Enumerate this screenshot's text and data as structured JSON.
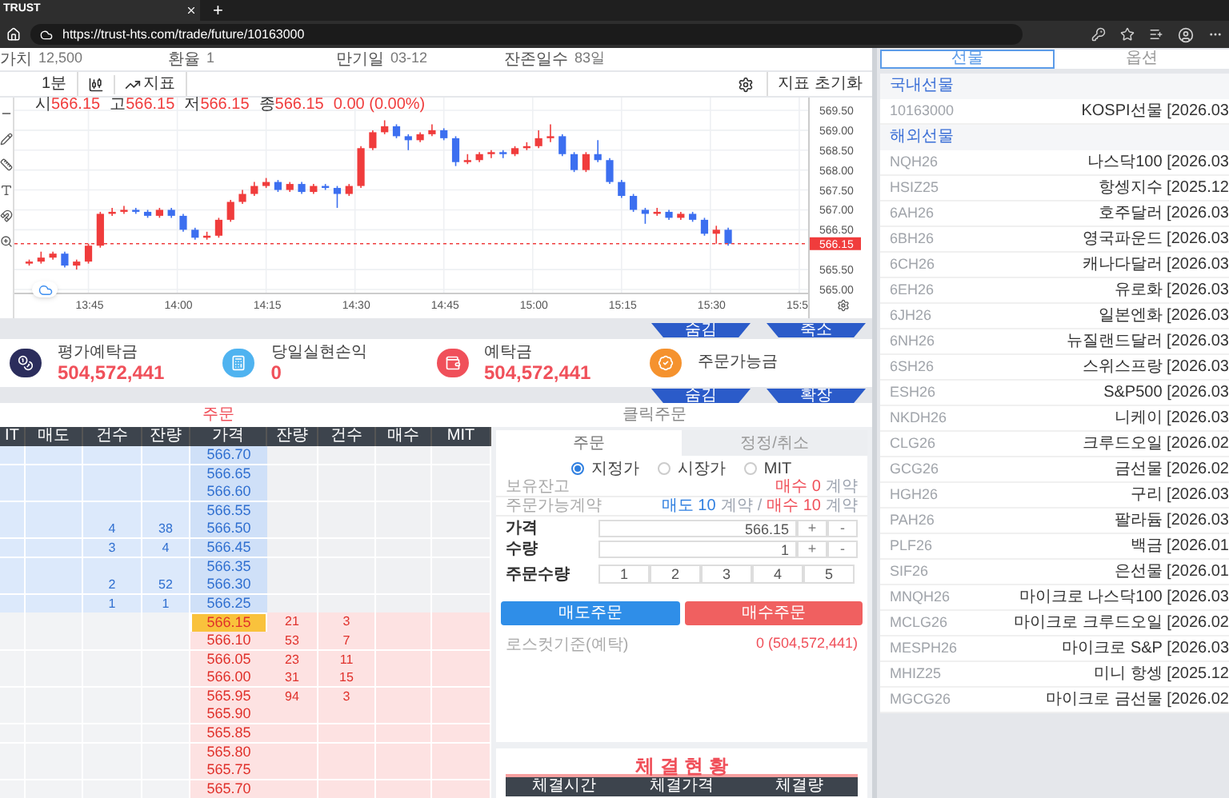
{
  "browser": {
    "tab_title": "TRUST",
    "new_tab": "+",
    "url": "https://trust-hts.com/trade/future/10163000"
  },
  "info": [
    {
      "label": "가치",
      "value": "12,500"
    },
    {
      "label": "환율",
      "value": "1"
    },
    {
      "label": "만기일",
      "value": "03-12"
    },
    {
      "label": "잔존일수",
      "value": "83일"
    }
  ],
  "toolbar": {
    "interval": "1분",
    "indicator": "지표",
    "reset": "지표 초기화"
  },
  "chart": {
    "ohlc": [
      {
        "label": "시",
        "value": "566.15"
      },
      {
        "label": "고",
        "value": "566.15"
      },
      {
        "label": "저",
        "value": "566.15"
      },
      {
        "label": "종",
        "value": "566.15"
      }
    ],
    "change": "0.00 (0.00%)",
    "chart_data": {
      "type": "candlestick",
      "x": [
        815,
        817,
        819,
        821,
        823,
        825,
        827,
        829,
        831,
        833,
        835,
        837,
        839,
        841,
        843,
        845,
        847,
        849,
        851,
        853,
        855,
        857,
        859,
        861,
        863,
        865,
        867,
        869,
        871,
        873,
        875,
        877,
        879,
        881,
        883,
        885,
        887,
        889,
        891,
        893,
        895,
        897,
        899,
        901,
        903,
        905,
        907,
        909,
        911,
        913,
        915,
        917,
        919,
        921,
        923,
        925,
        927,
        929,
        931,
        933
      ],
      "ohlc": [
        [
          565.65,
          565.75,
          565.6,
          565.7
        ],
        [
          565.7,
          565.95,
          565.65,
          565.8
        ],
        [
          565.8,
          565.95,
          565.75,
          565.9
        ],
        [
          565.9,
          565.95,
          565.55,
          565.6
        ],
        [
          565.6,
          565.75,
          565.5,
          565.7
        ],
        [
          565.7,
          566.15,
          565.65,
          566.1
        ],
        [
          566.1,
          566.95,
          566.05,
          566.9
        ],
        [
          566.9,
          567.05,
          566.85,
          566.95
        ],
        [
          566.95,
          567.1,
          566.9,
          567.0
        ],
        [
          567.0,
          567.05,
          566.9,
          566.95
        ],
        [
          566.95,
          567.0,
          566.8,
          566.85
        ],
        [
          566.85,
          567.05,
          566.8,
          567.0
        ],
        [
          567.0,
          567.05,
          566.8,
          566.85
        ],
        [
          566.85,
          566.9,
          566.45,
          566.5
        ],
        [
          566.5,
          566.55,
          566.25,
          566.3
        ],
        [
          566.3,
          566.45,
          566.25,
          566.35
        ],
        [
          566.35,
          566.8,
          566.3,
          566.75
        ],
        [
          566.75,
          567.25,
          566.7,
          567.2
        ],
        [
          567.2,
          567.5,
          567.15,
          567.4
        ],
        [
          567.4,
          567.7,
          567.35,
          567.6
        ],
        [
          567.6,
          567.8,
          567.55,
          567.7
        ],
        [
          567.7,
          567.75,
          567.45,
          567.5
        ],
        [
          567.5,
          567.7,
          567.45,
          567.65
        ],
        [
          567.65,
          567.7,
          567.4,
          567.45
        ],
        [
          567.45,
          567.65,
          567.4,
          567.6
        ],
        [
          567.6,
          567.65,
          567.5,
          567.55
        ],
        [
          567.55,
          567.6,
          567.05,
          567.4
        ],
        [
          567.4,
          567.65,
          567.35,
          567.6
        ],
        [
          567.6,
          568.6,
          567.55,
          568.55
        ],
        [
          568.55,
          569.0,
          568.5,
          568.95
        ],
        [
          568.95,
          569.25,
          568.9,
          569.1
        ],
        [
          569.1,
          569.15,
          568.8,
          568.85
        ],
        [
          568.85,
          568.9,
          568.5,
          568.75
        ],
        [
          568.75,
          568.95,
          568.7,
          568.9
        ],
        [
          568.9,
          569.15,
          568.85,
          569.0
        ],
        [
          569.0,
          569.05,
          568.75,
          568.8
        ],
        [
          568.8,
          568.85,
          568.1,
          568.2
        ],
        [
          568.2,
          568.4,
          568.15,
          568.25
        ],
        [
          568.25,
          568.45,
          568.2,
          568.4
        ],
        [
          568.4,
          568.5,
          568.3,
          568.45
        ],
        [
          568.45,
          568.5,
          568.3,
          568.4
        ],
        [
          568.4,
          568.6,
          568.35,
          568.55
        ],
        [
          568.55,
          568.7,
          568.5,
          568.6
        ],
        [
          568.6,
          569.0,
          568.55,
          568.8
        ],
        [
          568.8,
          569.15,
          568.7,
          568.85
        ],
        [
          568.85,
          568.9,
          568.35,
          568.4
        ],
        [
          568.4,
          568.45,
          567.95,
          568.0
        ],
        [
          568.0,
          568.45,
          567.95,
          568.4
        ],
        [
          568.4,
          568.75,
          568.2,
          568.25
        ],
        [
          568.25,
          568.3,
          567.65,
          567.7
        ],
        [
          567.7,
          567.75,
          567.3,
          567.35
        ],
        [
          567.35,
          567.4,
          566.95,
          567.0
        ],
        [
          567.0,
          567.05,
          566.65,
          566.9
        ],
        [
          566.9,
          567.05,
          566.85,
          566.95
        ],
        [
          566.95,
          567.0,
          566.75,
          566.8
        ],
        [
          566.8,
          566.95,
          566.75,
          566.9
        ],
        [
          566.9,
          566.95,
          566.7,
          566.75
        ],
        [
          566.75,
          566.8,
          566.35,
          566.4
        ],
        [
          566.4,
          566.6,
          566.15,
          566.5
        ],
        [
          566.5,
          566.55,
          566.1,
          566.15
        ]
      ],
      "xticks": [
        {
          "value": 825,
          "label": "13:45"
        },
        {
          "value": 840,
          "label": "14:00"
        },
        {
          "value": 855,
          "label": "14:15"
        },
        {
          "value": 870,
          "label": "14:30"
        },
        {
          "value": 885,
          "label": "14:45"
        },
        {
          "value": 900,
          "label": "15:00"
        },
        {
          "value": 915,
          "label": "15:15"
        },
        {
          "value": 930,
          "label": "15:30"
        },
        {
          "value": 945,
          "label": "15:5"
        }
      ],
      "yticks": [
        {
          "value": 569.5,
          "label": "569.50"
        },
        {
          "value": 569.0,
          "label": "569.00"
        },
        {
          "value": 568.5,
          "label": "568.50"
        },
        {
          "value": 568.0,
          "label": "568.00"
        },
        {
          "value": 567.5,
          "label": "567.50"
        },
        {
          "value": 567.0,
          "label": "567.00"
        },
        {
          "value": 566.5,
          "label": "566.50"
        },
        {
          "value": 565.5,
          "label": "565.50"
        },
        {
          "value": 565.0,
          "label": "565.00"
        }
      ],
      "ylim": [
        565.0,
        569.5
      ],
      "xlim": [
        812.5,
        946.5
      ],
      "grid": true,
      "ref_lines": [
        {
          "axis": "y",
          "value": 566.15,
          "label": "566.15"
        }
      ]
    }
  },
  "chart_flaps": [
    "숨김",
    "축소"
  ],
  "cards": [
    {
      "kind": "coin",
      "label": "평가예탁금",
      "value": "504,572,441",
      "color": "#2b2d5c"
    },
    {
      "kind": "calculator",
      "label": "당일실현손익",
      "value": "0",
      "color": "#4fb3f0"
    },
    {
      "kind": "wallet",
      "label": "예탁금",
      "value": "504,572,441",
      "color": "#f0505a"
    },
    {
      "kind": "check",
      "label": "주문가능금",
      "color": "#f5922e"
    }
  ],
  "card_flaps": [
    "숨김",
    "확장"
  ],
  "order_tabs": [
    {
      "label": "주문",
      "selected": true
    },
    {
      "label": "클릭주문",
      "selected": false
    }
  ],
  "order_book": {
    "columns": [
      "IT",
      "매도",
      "건수",
      "잔량",
      "가격",
      "잔량",
      "건수",
      "매수",
      "MIT"
    ],
    "rows": [
      {
        "kind": "ask",
        "price": "566.70",
        "current": false
      },
      {
        "kind": "ask",
        "price": "566.65",
        "current": false
      },
      {
        "kind": "ask",
        "price": "566.60",
        "current": false
      },
      {
        "kind": "ask",
        "price": "566.55",
        "current": false
      },
      {
        "kind": "ask",
        "price": "566.50",
        "count": "4",
        "qty": "38",
        "current": false
      },
      {
        "kind": "ask",
        "price": "566.45",
        "count": "3",
        "qty": "4",
        "current": false
      },
      {
        "kind": "ask",
        "price": "566.35",
        "current": false
      },
      {
        "kind": "ask",
        "price": "566.30",
        "count": "2",
        "qty": "52",
        "current": false
      },
      {
        "kind": "ask",
        "price": "566.25",
        "count": "1",
        "qty": "1",
        "current": false
      },
      {
        "kind": "bid",
        "price": "566.15",
        "qty": "21",
        "count": "3",
        "current": true
      },
      {
        "kind": "bid",
        "price": "566.10",
        "qty": "53",
        "count": "7",
        "current": false
      },
      {
        "kind": "bid",
        "price": "566.05",
        "qty": "23",
        "count": "11",
        "current": false
      },
      {
        "kind": "bid",
        "price": "566.00",
        "qty": "31",
        "count": "15",
        "current": false
      },
      {
        "kind": "bid",
        "price": "565.95",
        "qty": "94",
        "count": "3",
        "current": false
      },
      {
        "kind": "bid",
        "price": "565.90",
        "current": false
      },
      {
        "kind": "bid",
        "price": "565.85",
        "current": false
      },
      {
        "kind": "bid",
        "price": "565.80",
        "current": false
      },
      {
        "kind": "bid",
        "price": "565.75",
        "current": false
      },
      {
        "kind": "bid",
        "price": "565.70",
        "current": false
      }
    ]
  },
  "order_form": {
    "tabs": [
      {
        "label": "주문",
        "selected": true
      },
      {
        "label": "정정/취소",
        "selected": false
      }
    ],
    "price_types": [
      {
        "label": "지정가",
        "selected": true
      },
      {
        "label": "시장가",
        "selected": false
      },
      {
        "label": "MIT",
        "selected": false
      }
    ],
    "holding": {
      "label": "보유잔고",
      "segments": [
        {
          "text": "매수 0",
          "kind": "buy"
        },
        {
          "text": "계약",
          "kind": "plain"
        }
      ]
    },
    "available": {
      "label": "주문가능계약",
      "segments": [
        {
          "text": "매도 10",
          "kind": "sell"
        },
        {
          "text": "계약",
          "kind": "plain"
        },
        {
          "text": "/",
          "kind": "plain"
        },
        {
          "text": "매수 10",
          "kind": "buy"
        },
        {
          "text": "계약",
          "kind": "plain"
        }
      ]
    },
    "price": {
      "label": "가격",
      "value": "566.15",
      "plus": "+",
      "minus": "-"
    },
    "quantity": {
      "label": "수량",
      "value": "1",
      "plus": "+",
      "minus": "-"
    },
    "quick_qty": {
      "label": "주문수량",
      "options": [
        "1",
        "2",
        "3",
        "4",
        "5"
      ]
    },
    "sell_button": "매도주문",
    "buy_button": "매수주문",
    "losscut": {
      "label": "로스컷기준(예탁)",
      "value": "0 (504,572,441)"
    }
  },
  "executions": {
    "title": "체 결 현 황",
    "columns": [
      "체결시간",
      "체결가격",
      "체결량"
    ]
  },
  "market_list": {
    "tabs": [
      {
        "label": "선물",
        "selected": true
      },
      {
        "label": "옵션",
        "selected": false
      }
    ],
    "sections": [
      {
        "title": "국내선물",
        "items": [
          {
            "code": "10163000",
            "name": "KOSPI선물 [2026.03"
          }
        ]
      },
      {
        "title": "해외선물",
        "items": [
          {
            "code": "NQH26",
            "name": "나스닥100 [2026.03"
          },
          {
            "code": "HSIZ25",
            "name": "항셍지수 [2025.12"
          },
          {
            "code": "6AH26",
            "name": "호주달러 [2026.03"
          },
          {
            "code": "6BH26",
            "name": "영국파운드 [2026.03"
          },
          {
            "code": "6CH26",
            "name": "캐나다달러 [2026.03"
          },
          {
            "code": "6EH26",
            "name": "유로화 [2026.03"
          },
          {
            "code": "6JH26",
            "name": "일본엔화 [2026.03"
          },
          {
            "code": "6NH26",
            "name": "뉴질랜드달러 [2026.03"
          },
          {
            "code": "6SH26",
            "name": "스위스프랑 [2026.03"
          },
          {
            "code": "ESH26",
            "name": "S&P500 [2026.03"
          },
          {
            "code": "NKDH26",
            "name": "니케이 [2026.03"
          },
          {
            "code": "CLG26",
            "name": "크루드오일 [2026.02"
          },
          {
            "code": "GCG26",
            "name": "금선물 [2026.02"
          },
          {
            "code": "HGH26",
            "name": "구리 [2026.03"
          },
          {
            "code": "PAH26",
            "name": "팔라듐 [2026.03"
          },
          {
            "code": "PLF26",
            "name": "백금 [2026.01"
          },
          {
            "code": "SIF26",
            "name": "은선물 [2026.01"
          },
          {
            "code": "MNQH26",
            "name": "마이크로 나스닥100 [2026.03"
          },
          {
            "code": "MCLG26",
            "name": "마이크로 크루드오일 [2026.02"
          },
          {
            "code": "MESPH26",
            "name": "마이크로 S&P [2026.03"
          },
          {
            "code": "MHIZ25",
            "name": "미니 항셍 [2025.12"
          },
          {
            "code": "MGCG26",
            "name": "마이크로 금선물 [2026.02"
          }
        ]
      }
    ]
  }
}
